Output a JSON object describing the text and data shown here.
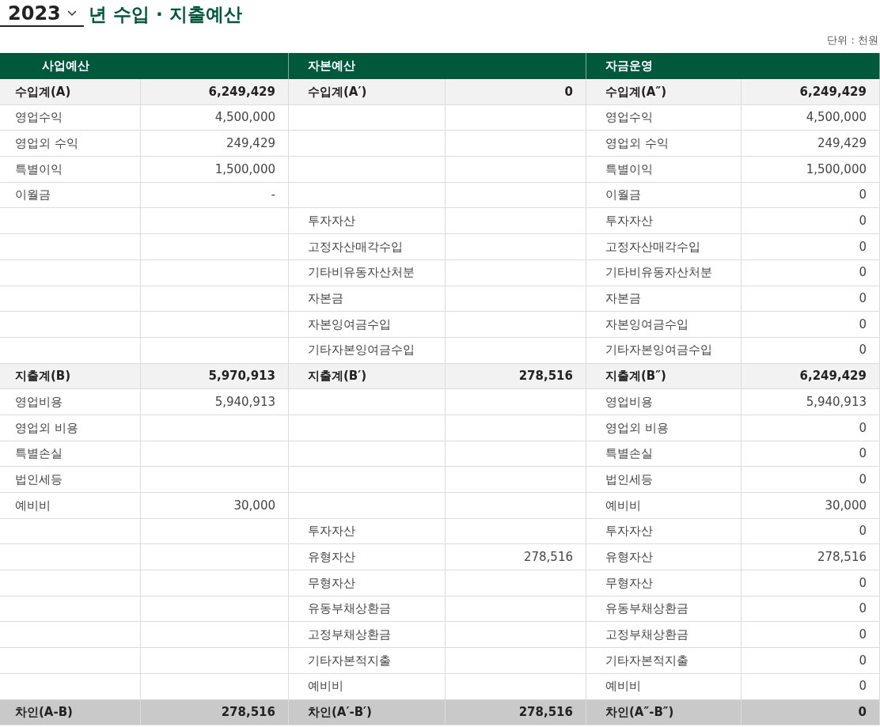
{
  "year_select": {
    "value": "2023"
  },
  "title": "년 수입 · 지출예산",
  "unit": "단위 : 천원",
  "columns": [
    "사업예산",
    "자본예산",
    "자금운영"
  ],
  "rows": [
    {
      "kind": "subtotal",
      "business": {
        "label": "수입계(A)",
        "value": "6,249,429"
      },
      "capital": {
        "label": "수입계(A′)",
        "value": "0"
      },
      "fund": {
        "label": "수입계(A″)",
        "value": "6,249,429"
      }
    },
    {
      "kind": "item",
      "business": {
        "label": "영업수익",
        "value": "4,500,000"
      },
      "fund": {
        "label": "영업수익",
        "value": "4,500,000"
      }
    },
    {
      "kind": "item",
      "business": {
        "label": "영업외 수익",
        "value": "249,429"
      },
      "fund": {
        "label": "영업외 수익",
        "value": "249,429"
      }
    },
    {
      "kind": "item",
      "business": {
        "label": "특별이익",
        "value": "1,500,000"
      },
      "fund": {
        "label": "특별이익",
        "value": "1,500,000"
      }
    },
    {
      "kind": "item",
      "business": {
        "label": "이월금",
        "value": "-"
      },
      "fund": {
        "label": "이월금",
        "value": "0"
      }
    },
    {
      "kind": "item",
      "capital": {
        "label": "투자자산"
      },
      "fund": {
        "label": "투자자산",
        "value": "0"
      }
    },
    {
      "kind": "item",
      "capital": {
        "label": "고정자산매각수입"
      },
      "fund": {
        "label": "고정자산매각수입",
        "value": "0"
      }
    },
    {
      "kind": "item",
      "capital": {
        "label": "기타비유동자산처분"
      },
      "fund": {
        "label": "기타비유동자산처분",
        "value": "0"
      }
    },
    {
      "kind": "item",
      "capital": {
        "label": "자본금"
      },
      "fund": {
        "label": "자본금",
        "value": "0"
      }
    },
    {
      "kind": "item",
      "capital": {
        "label": "자본잉여금수입"
      },
      "fund": {
        "label": "자본잉여금수입",
        "value": "0"
      }
    },
    {
      "kind": "item",
      "capital": {
        "label": "기타자본잉여금수입"
      },
      "fund": {
        "label": "기타자본잉여금수입",
        "value": "0"
      }
    },
    {
      "kind": "subtotal",
      "business": {
        "label": "지출계(B)",
        "value": "5,970,913"
      },
      "capital": {
        "label": "지출계(B′)",
        "value": "278,516"
      },
      "fund": {
        "label": "지출계(B″)",
        "value": "6,249,429"
      }
    },
    {
      "kind": "item",
      "business": {
        "label": "영업비용",
        "value": "5,940,913"
      },
      "fund": {
        "label": "영업비용",
        "value": "5,940,913"
      }
    },
    {
      "kind": "item",
      "business": {
        "label": "영업외 비용"
      },
      "fund": {
        "label": "영업외 비용",
        "value": "0"
      }
    },
    {
      "kind": "item",
      "business": {
        "label": "특별손실"
      },
      "fund": {
        "label": "특별손실",
        "value": "0"
      }
    },
    {
      "kind": "item",
      "business": {
        "label": "법인세등"
      },
      "fund": {
        "label": "법인세등",
        "value": "0"
      }
    },
    {
      "kind": "item",
      "business": {
        "label": "예비비",
        "value": "30,000"
      },
      "fund": {
        "label": "예비비",
        "value": "30,000"
      }
    },
    {
      "kind": "item",
      "capital": {
        "label": "투자자산"
      },
      "fund": {
        "label": "투자자산",
        "value": "0"
      }
    },
    {
      "kind": "item",
      "capital": {
        "label": "유형자산",
        "value": "278,516"
      },
      "fund": {
        "label": "유형자산",
        "value": "278,516"
      }
    },
    {
      "kind": "item",
      "capital": {
        "label": "무형자산"
      },
      "fund": {
        "label": "무형자산",
        "value": "0"
      }
    },
    {
      "kind": "item",
      "capital": {
        "label": "유동부채상환금"
      },
      "fund": {
        "label": "유동부채상환금",
        "value": "0"
      }
    },
    {
      "kind": "item",
      "capital": {
        "label": "고정부채상환금"
      },
      "fund": {
        "label": "고정부채상환금",
        "value": "0"
      }
    },
    {
      "kind": "item",
      "capital": {
        "label": "기타자본적지출"
      },
      "fund": {
        "label": "기타자본적지출",
        "value": "0"
      }
    },
    {
      "kind": "item",
      "capital": {
        "label": "예비비"
      },
      "fund": {
        "label": "예비비",
        "value": "0"
      }
    },
    {
      "kind": "total",
      "business": {
        "label": "차인(A-B)",
        "value": "278,516"
      },
      "capital": {
        "label": "차인(A′-B′)",
        "value": "278,516"
      },
      "fund": {
        "label": "차인(A″-B″)",
        "value": "0"
      }
    }
  ]
}
